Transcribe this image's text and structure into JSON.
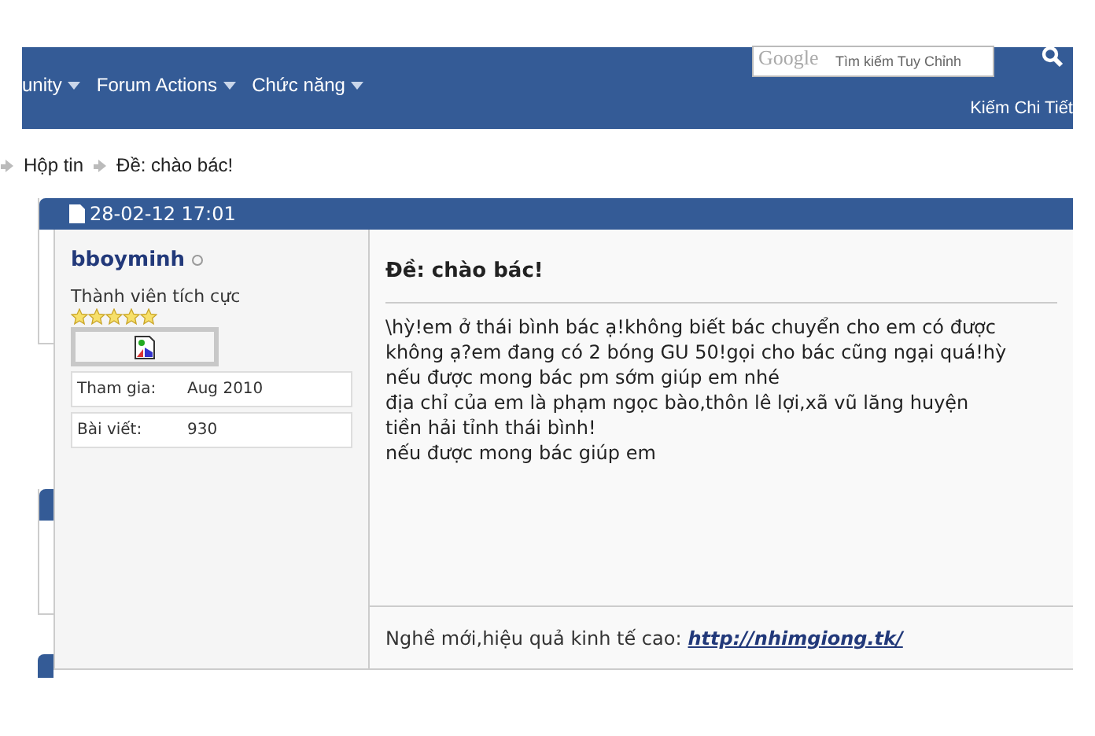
{
  "header": {
    "nav": [
      {
        "label": "unity"
      },
      {
        "label": "Forum Actions"
      },
      {
        "label": "Chức năng"
      }
    ],
    "search": {
      "brand": "Google",
      "placeholder": "Tìm kiếm Tuy Chỉnh"
    },
    "advanced_search": "Kiếm Chi Tiết"
  },
  "breadcrumb": [
    "Hộp tin",
    "Đề: chào bác!"
  ],
  "post": {
    "date": "28-02-12 17:01",
    "user": {
      "name": "bboyminh",
      "online": false,
      "rank": "Thành viên tích cực",
      "stars": 5,
      "info": [
        {
          "label": "Tham gia:",
          "value": "Aug 2010"
        },
        {
          "label": "Bài viết:",
          "value": "930"
        }
      ]
    },
    "title": "Đề: chào bác!",
    "body": [
      "\\hỳ!em ở thái bình bác ạ!không biết bác chuyển cho em có được không ạ?em đang có 2 bóng GU 50!gọi cho bác cũng ngại quá!hỳ",
      "nếu được mong bác pm sớm giúp em nhé",
      "địa chỉ của em là phạm ngọc bào,thôn lê lợi,xã vũ lăng huyện tiền hải tỉnh thái bình!",
      "nếu được mong bác giúp em"
    ],
    "signature": {
      "text": "Nghề mới,hiệu quả kinh tế cao:",
      "link": "http://nhimgiong.tk/"
    }
  }
}
